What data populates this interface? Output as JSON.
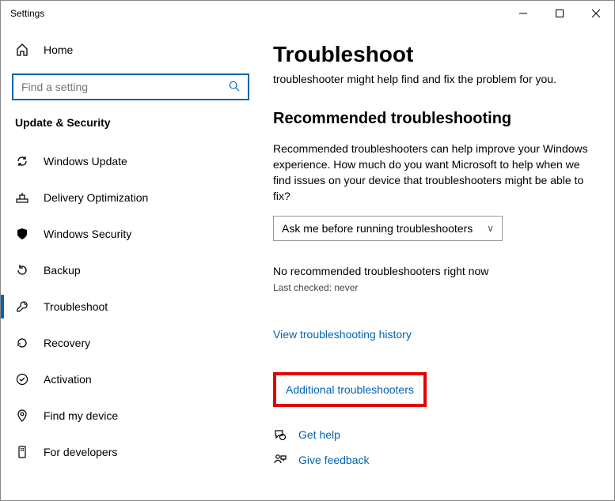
{
  "window": {
    "title": "Settings"
  },
  "sidebar": {
    "home": "Home",
    "search_placeholder": "Find a setting",
    "category": "Update & Security",
    "items": [
      {
        "label": "Windows Update"
      },
      {
        "label": "Delivery Optimization"
      },
      {
        "label": "Windows Security"
      },
      {
        "label": "Backup"
      },
      {
        "label": "Troubleshoot"
      },
      {
        "label": "Recovery"
      },
      {
        "label": "Activation"
      },
      {
        "label": "Find my device"
      },
      {
        "label": "For developers"
      }
    ]
  },
  "main": {
    "title": "Troubleshoot",
    "intro": "troubleshooter might help find and fix the problem for you.",
    "section_heading": "Recommended troubleshooting",
    "section_desc": "Recommended troubleshooters can help improve your Windows experience. How much do you want Microsoft to help when we find issues on your device that troubleshooters might be able to fix?",
    "dropdown_value": "Ask me before running troubleshooters",
    "status_none": "No recommended troubleshooters right now",
    "last_checked": "Last checked: never",
    "history_link": "View troubleshooting history",
    "additional_link": "Additional troubleshooters",
    "get_help": "Get help",
    "give_feedback": "Give feedback"
  }
}
